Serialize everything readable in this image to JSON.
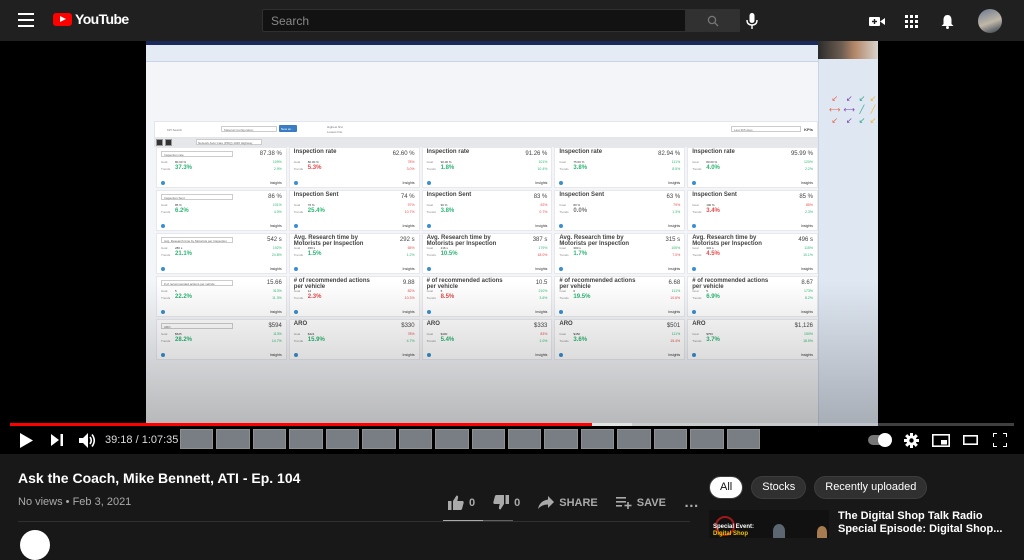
{
  "header": {
    "logo_text": "YouTube",
    "search_placeholder": "Search",
    "icons": [
      "menu-icon",
      "search-icon",
      "microphone-icon",
      "create-video-icon",
      "apps-grid-icon",
      "notifications-bell-icon",
      "account-avatar"
    ]
  },
  "player": {
    "current_time": "39:18",
    "duration": "1:07:35",
    "time_display": "39:18 / 1:07:35",
    "progress_fraction": 0.58,
    "buffered_fraction": 0.62,
    "accent_color": "#ff0000",
    "controls": [
      "play",
      "next",
      "volume",
      "autoplay",
      "settings",
      "miniplayer",
      "theater",
      "fullscreen"
    ]
  },
  "screen_recording": {
    "dashboard_header": {
      "kpi_search_label": "KPI Search",
      "configuration_select": "Material Configuration",
      "new_button": "New ac..",
      "radio_1": "Highest first",
      "radio_2": "Lowest first",
      "date_range": "Last 365 days",
      "kpis_label": "KPIs",
      "location_select": "Network Auto Care (PDQ) 1026 Highway"
    },
    "cards": [
      [
        {
          "title": "Inspection rate",
          "is_select": true,
          "value": "87.38 %",
          "goal": "80.00 %",
          "goal_pct": "109%",
          "goal_color": "green",
          "trend": "37.3%",
          "trend_color": "green",
          "trend2": "2.9%",
          "trend2_color": "green"
        },
        {
          "title": "Inspection rate",
          "value": "62.60 %",
          "goal": "80.00 %",
          "goal_pct": "78%",
          "goal_color": "red",
          "trend": "5.3%",
          "trend_color": "red",
          "trend2": "3.0%",
          "trend2_color": "red"
        },
        {
          "title": "Inspection rate",
          "value": "91.26 %",
          "goal": "90.00 %",
          "goal_pct": "101%",
          "goal_color": "green",
          "trend": "1.8%",
          "trend_color": "green",
          "trend2": "10.4%",
          "trend2_color": "green"
        },
        {
          "title": "Inspection rate",
          "value": "82.94 %",
          "goal": "75.00 %",
          "goal_pct": "111%",
          "goal_color": "green",
          "trend": "3.8%",
          "trend_color": "green",
          "trend2": "8.5%",
          "trend2_color": "green"
        },
        {
          "title": "Inspection rate",
          "value": "95.99 %",
          "goal": "80.00 %",
          "goal_pct": "120%",
          "goal_color": "green",
          "trend": "4.0%",
          "trend_color": "green",
          "trend2": "2.2%",
          "trend2_color": "green"
        }
      ],
      [
        {
          "title": "Inspection Sent",
          "is_select": true,
          "value": "86 %",
          "goal": "85 %",
          "goal_pct": "101%",
          "goal_color": "green",
          "trend": "6.2%",
          "trend_color": "green",
          "trend2": "4.0%",
          "trend2_color": "green"
        },
        {
          "title": "Inspection Sent",
          "value": "74 %",
          "goal": "76 %",
          "goal_pct": "97%",
          "goal_color": "red",
          "trend": "25.4%",
          "trend_color": "green",
          "trend2": "10.7%",
          "trend2_color": "red"
        },
        {
          "title": "Inspection Sent",
          "value": "83 %",
          "goal": "90 %",
          "goal_pct": "92%",
          "goal_color": "red",
          "trend": "3.8%",
          "trend_color": "green",
          "trend2": "0.7%",
          "trend2_color": "red"
        },
        {
          "title": "Inspection Sent",
          "value": "63 %",
          "goal": "80 %",
          "goal_pct": "79%",
          "goal_color": "red",
          "trend": "0.0%",
          "trend_color": "gray",
          "trend2": "1.3%",
          "trend2_color": "green"
        },
        {
          "title": "Inspection Sent",
          "value": "85 %",
          "goal": "100 %",
          "goal_pct": "85%",
          "goal_color": "red",
          "trend": "3.4%",
          "trend_color": "red",
          "trend2": "2.3%",
          "trend2_color": "green"
        }
      ],
      [
        {
          "title": "Avg. Research time by Motorists per Inspection",
          "is_select": true,
          "value": "542 s",
          "goal": "280 s",
          "goal_pct": "192%",
          "goal_color": "green",
          "trend": "21.1%",
          "trend_color": "green",
          "trend2": "24.8%",
          "trend2_color": "green"
        },
        {
          "title": "Avg. Research time by Motorists per Inspection",
          "value": "292 s",
          "goal": "450 s",
          "goal_pct": "65%",
          "goal_color": "red",
          "trend": "1.5%",
          "trend_color": "green",
          "trend2": "1.2%",
          "trend2_color": "green"
        },
        {
          "title": "Avg. Research time by Motorists per Inspection",
          "value": "387 s",
          "goal": "216 s",
          "goal_pct": "179%",
          "goal_color": "green",
          "trend": "10.5%",
          "trend_color": "green",
          "trend2": "18.0%",
          "trend2_color": "red"
        },
        {
          "title": "Avg. Research time by Motorists per Inspection",
          "value": "315 s",
          "goal": "300 s",
          "goal_pct": "105%",
          "goal_color": "green",
          "trend": "1.7%",
          "trend_color": "green",
          "trend2": "7.0%",
          "trend2_color": "red"
        },
        {
          "title": "Avg. Research time by Motorists per Inspection",
          "value": "496 s",
          "goal": "431 s",
          "goal_pct": "115%",
          "goal_color": "green",
          "trend": "4.5%",
          "trend_color": "red",
          "trend2": "10.1%",
          "trend2_color": "green"
        }
      ],
      [
        {
          "title": "# of recommended actions per vehicle",
          "is_select": true,
          "value": "15.66",
          "goal": "5",
          "goal_pct": "313%",
          "goal_color": "green",
          "trend": "22.2%",
          "trend_color": "green",
          "trend2": "11.3%",
          "trend2_color": "green"
        },
        {
          "title": "# of recommended actions per vehicle",
          "value": "9.88",
          "goal": "12",
          "goal_pct": "82%",
          "goal_color": "red",
          "trend": "2.3%",
          "trend_color": "red",
          "trend2": "10.3%",
          "trend2_color": "red"
        },
        {
          "title": "# of recommended actions per vehicle",
          "value": "10.5",
          "goal": "5",
          "goal_pct": "210%",
          "goal_color": "green",
          "trend": "8.5%",
          "trend_color": "red",
          "trend2": "3.6%",
          "trend2_color": "green"
        },
        {
          "title": "# of recommended actions per vehicle",
          "value": "6.68",
          "goal": "6",
          "goal_pct": "111%",
          "goal_color": "green",
          "trend": "19.5%",
          "trend_color": "green",
          "trend2": "10.6%",
          "trend2_color": "red"
        },
        {
          "title": "# of recommended actions per vehicle",
          "value": "8.67",
          "goal": "5",
          "goal_pct": "173%",
          "goal_color": "green",
          "trend": "6.9%",
          "trend_color": "green",
          "trend2": "8.2%",
          "trend2_color": "green"
        }
      ],
      [
        {
          "title": "ARO",
          "is_select": true,
          "value": "$594",
          "goal": "$525",
          "goal_pct": "113%",
          "goal_color": "green",
          "trend": "28.2%",
          "trend_color": "green",
          "trend2": "14.7%",
          "trend2_color": "green"
        },
        {
          "title": "ARO",
          "value": "$330",
          "goal": "$421",
          "goal_pct": "78%",
          "goal_color": "red",
          "trend": "15.9%",
          "trend_color": "green",
          "trend2": "4.7%",
          "trend2_color": "green"
        },
        {
          "title": "ARO",
          "value": "$333",
          "goal": "$400",
          "goal_pct": "83%",
          "goal_color": "red",
          "trend": "5.4%",
          "trend_color": "green",
          "trend2": "1.0%",
          "trend2_color": "green"
        },
        {
          "title": "ARO",
          "value": "$501",
          "goal": "$450",
          "goal_pct": "111%",
          "goal_color": "green",
          "trend": "3.6%",
          "trend_color": "green",
          "trend2": "15.4%",
          "trend2_color": "red"
        },
        {
          "title": "ARO",
          "value": "$1,126",
          "goal": "$750",
          "goal_pct": "150%",
          "goal_color": "green",
          "trend": "3.7%",
          "trend_color": "green",
          "trend2": "18.5%",
          "trend2_color": "green"
        }
      ]
    ],
    "labels": {
      "goal": "Goal",
      "trends": "Trends",
      "insights": "Insights"
    },
    "arrow_colors": [
      "#e8624a",
      "#7b3fb0",
      "#2aa38a",
      "#e8b732"
    ]
  },
  "video": {
    "title": "Ask the Coach, Mike Bennett, ATI - Ep. 104",
    "views": "No views",
    "date": "Feb 3, 2021",
    "meta": "No views • Feb 3, 2021",
    "likes": "0",
    "dislikes": "0",
    "share_label": "SHARE",
    "save_label": "SAVE",
    "more_label": "…"
  },
  "sidebar": {
    "chips": [
      "All",
      "Stocks",
      "Recently uploaded"
    ],
    "active_chip": "All",
    "recommended": [
      {
        "title": "The Digital Shop Talk Radio Special Episode: Digital Shop...",
        "thumb_line1": "Special Event:",
        "thumb_line2": "Digital Shop"
      }
    ]
  }
}
